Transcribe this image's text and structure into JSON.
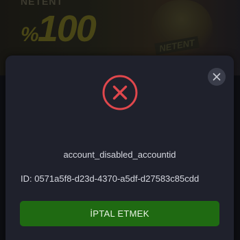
{
  "banner": {
    "brand": "NETENT",
    "promo_value": "100",
    "promo_symbol": "%",
    "art_tag": "NETENT"
  },
  "modal": {
    "status_icon": "error-x-icon",
    "close_icon": "close-icon",
    "message": "account_disabled_accountid",
    "account_id": "ID: 0571a5f8-d23d-4370-a5df-d27583c85cdd",
    "cancel_label": "İPTAL ETMEK"
  },
  "colors": {
    "modal_bg": "#1f212c",
    "error_red": "#e0474c",
    "button_green": "#1f6a12",
    "text": "#d6d8e0"
  }
}
